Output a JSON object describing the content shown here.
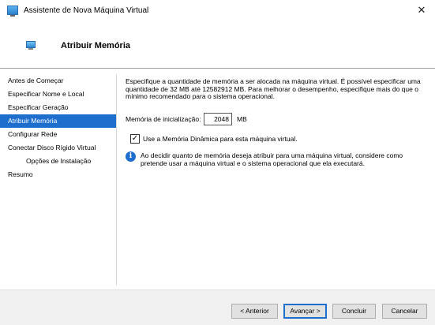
{
  "window": {
    "title": "Assistente de Nova Máquina Virtual",
    "close_label": "✕"
  },
  "header": {
    "title": "Atribuir Memória"
  },
  "nav": {
    "items": [
      {
        "label": "Antes de Começar",
        "selected": false,
        "sub": false
      },
      {
        "label": "Especificar Nome e Local",
        "selected": false,
        "sub": false
      },
      {
        "label": "Especificar Geração",
        "selected": false,
        "sub": false
      },
      {
        "label": "Atribuir Memória",
        "selected": true,
        "sub": false
      },
      {
        "label": "Configurar Rede",
        "selected": false,
        "sub": false
      },
      {
        "label": "Conectar Disco Rígido Virtual",
        "selected": false,
        "sub": false
      },
      {
        "label": "Opções de Instalação",
        "selected": false,
        "sub": true
      },
      {
        "label": "Resumo",
        "selected": false,
        "sub": false
      }
    ]
  },
  "content": {
    "description": "Especifique a quantidade de memória a ser alocada na máquina virtual. É possível especificar uma quantidade de 32 MB até 12582912 MB. Para melhorar o desempenho, especifique mais do que o mínimo recomendado para o sistema operacional.",
    "memory_label": "Memória de inicialização:",
    "memory_value": "2048",
    "memory_unit": "MB",
    "dynamic_memory_label": "Use a Memória Dinâmica para esta máquina virtual.",
    "dynamic_memory_checked": true,
    "info_text": "Ao decidir quanto de memória deseja atribuir para uma máquina virtual, considere como pretende usar a máquina virtual e o sistema operacional que ela executará."
  },
  "footer": {
    "back_label": "< Anterior",
    "next_label": "Avançar >",
    "finish_label": "Concluir",
    "cancel_label": "Cancelar"
  },
  "icons": {
    "app": "hyperv-vm-icon",
    "header": "memory-vm-icon",
    "info": "info-icon",
    "check": "checkmark-icon"
  },
  "colors": {
    "accent": "#1e6fcd",
    "footer_bg": "#f0f0f0"
  }
}
